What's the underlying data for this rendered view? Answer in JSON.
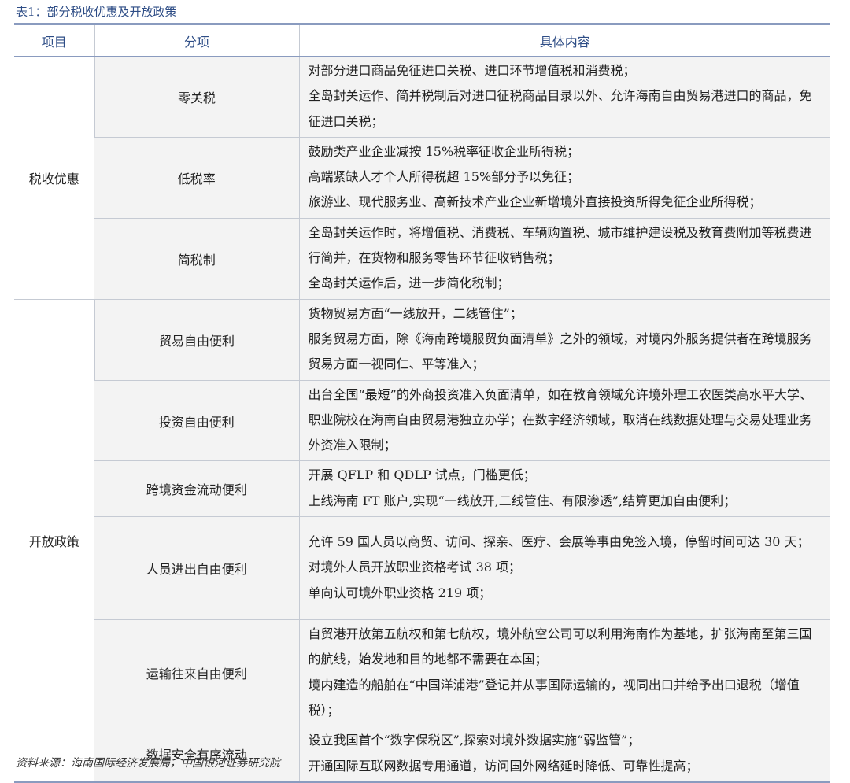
{
  "caption": "表1：部分税收优惠及开放政策",
  "headers": [
    "项目",
    "分项",
    "具体内容"
  ],
  "groups": [
    {
      "name": "税收优惠",
      "rows": [
        {
          "item": "零关税",
          "lines": [
            "对部分进口商品免征进口关税、进口环节增值税和消费税；",
            "全岛封关运作、简并税制后对进口征税商品目录以外、允许海南自由贸易港进口的商品，免征进口关税；"
          ]
        },
        {
          "item": "低税率",
          "lines": [
            "鼓励类产业企业减按 15%税率征收企业所得税；",
            "高端紧缺人才个人所得税超 15%部分予以免征；",
            "旅游业、现代服务业、高新技术产业企业新增境外直接投资所得免征企业所得税；"
          ]
        },
        {
          "item": "简税制",
          "lines": [
            "全岛封关运作时，将增值税、消费税、车辆购置税、城市维护建设税及教育费附加等税费进行简并，在货物和服务零售环节征收销售税；",
            "全岛封关运作后，进一步简化税制；"
          ]
        }
      ]
    },
    {
      "name": "开放政策",
      "rows": [
        {
          "item": "贸易自由便利",
          "lines": [
            "货物贸易方面“一线放开，二线管住”；",
            "服务贸易方面，除《海南跨境服贸负面清单》之外的领域，对境内外服务提供者在跨境服务贸易方面一视同仁、平等准入；"
          ]
        },
        {
          "item": "投资自由便利",
          "lines": [
            "出台全国“最短”的外商投资准入负面清单，如在教育领域允许境外理工农医类高水平大学、职业院校在海南自由贸易港独立办学；在数字经济领域，取消在线数据处理与交易处理业务外资准入限制；"
          ]
        },
        {
          "item": "跨境资金流动便利",
          "lines": [
            "开展 QFLP 和 QDLP 试点，门槛更低；",
            "上线海南 FT 账户,实现“一线放开,二线管住、有限渗透”,结算更加自由便利；"
          ]
        },
        {
          "item": "人员进出自由便利",
          "lines": [
            "允许 59 国人员以商贸、访问、探亲、医疗、会展等事由免签入境，停留时间可达 30 天；",
            "对境外人员开放职业资格考试 38 项；",
            "单向认可境外职业资格 219 项；"
          ]
        },
        {
          "item": "运输往来自由便利",
          "lines": [
            "自贸港开放第五航权和第七航权，境外航空公司可以利用海南作为基地，扩张海南至第三国的航线，始发地和目的地都不需要在本国；",
            "境内建造的船舶在“中国洋浦港”登记并从事国际运输的，视同出口并给予出口退税（增值税）；"
          ]
        },
        {
          "item": "数据安全有序流动",
          "lines": [
            "设立我国首个“数字保税区”,探索对境外数据实施“弱监管”；",
            "开通国际互联网数据专用通道，访问国外网络延时降低、可靠性提高；"
          ]
        }
      ]
    }
  ],
  "source": "资料来源：海南国际经济发展局，中国银河证券研究院"
}
